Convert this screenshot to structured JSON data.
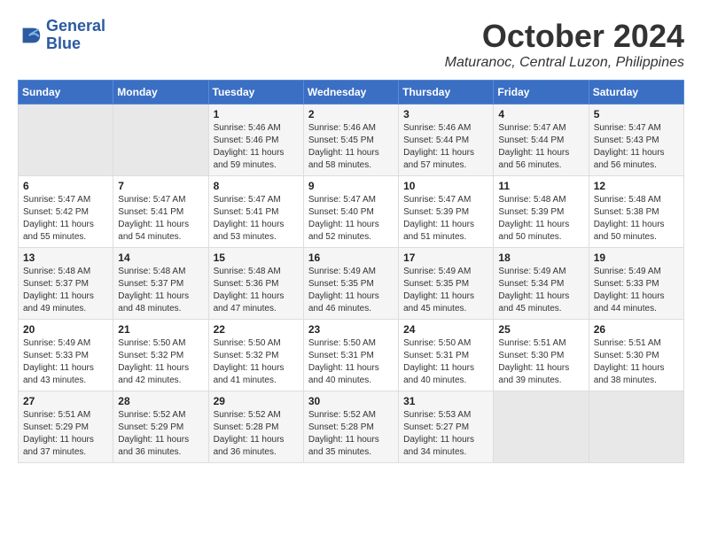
{
  "header": {
    "logo_line1": "General",
    "logo_line2": "Blue",
    "month_title": "October 2024",
    "location": "Maturanoc, Central Luzon, Philippines"
  },
  "days_of_week": [
    "Sunday",
    "Monday",
    "Tuesday",
    "Wednesday",
    "Thursday",
    "Friday",
    "Saturday"
  ],
  "weeks": [
    [
      {
        "day": "",
        "empty": true
      },
      {
        "day": "",
        "empty": true
      },
      {
        "day": "1",
        "sunrise": "5:46 AM",
        "sunset": "5:46 PM",
        "daylight": "11 hours and 59 minutes."
      },
      {
        "day": "2",
        "sunrise": "5:46 AM",
        "sunset": "5:45 PM",
        "daylight": "11 hours and 58 minutes."
      },
      {
        "day": "3",
        "sunrise": "5:46 AM",
        "sunset": "5:44 PM",
        "daylight": "11 hours and 57 minutes."
      },
      {
        "day": "4",
        "sunrise": "5:47 AM",
        "sunset": "5:44 PM",
        "daylight": "11 hours and 56 minutes."
      },
      {
        "day": "5",
        "sunrise": "5:47 AM",
        "sunset": "5:43 PM",
        "daylight": "11 hours and 56 minutes."
      }
    ],
    [
      {
        "day": "6",
        "sunrise": "5:47 AM",
        "sunset": "5:42 PM",
        "daylight": "11 hours and 55 minutes."
      },
      {
        "day": "7",
        "sunrise": "5:47 AM",
        "sunset": "5:41 PM",
        "daylight": "11 hours and 54 minutes."
      },
      {
        "day": "8",
        "sunrise": "5:47 AM",
        "sunset": "5:41 PM",
        "daylight": "11 hours and 53 minutes."
      },
      {
        "day": "9",
        "sunrise": "5:47 AM",
        "sunset": "5:40 PM",
        "daylight": "11 hours and 52 minutes."
      },
      {
        "day": "10",
        "sunrise": "5:47 AM",
        "sunset": "5:39 PM",
        "daylight": "11 hours and 51 minutes."
      },
      {
        "day": "11",
        "sunrise": "5:48 AM",
        "sunset": "5:39 PM",
        "daylight": "11 hours and 50 minutes."
      },
      {
        "day": "12",
        "sunrise": "5:48 AM",
        "sunset": "5:38 PM",
        "daylight": "11 hours and 50 minutes."
      }
    ],
    [
      {
        "day": "13",
        "sunrise": "5:48 AM",
        "sunset": "5:37 PM",
        "daylight": "11 hours and 49 minutes."
      },
      {
        "day": "14",
        "sunrise": "5:48 AM",
        "sunset": "5:37 PM",
        "daylight": "11 hours and 48 minutes."
      },
      {
        "day": "15",
        "sunrise": "5:48 AM",
        "sunset": "5:36 PM",
        "daylight": "11 hours and 47 minutes."
      },
      {
        "day": "16",
        "sunrise": "5:49 AM",
        "sunset": "5:35 PM",
        "daylight": "11 hours and 46 minutes."
      },
      {
        "day": "17",
        "sunrise": "5:49 AM",
        "sunset": "5:35 PM",
        "daylight": "11 hours and 45 minutes."
      },
      {
        "day": "18",
        "sunrise": "5:49 AM",
        "sunset": "5:34 PM",
        "daylight": "11 hours and 45 minutes."
      },
      {
        "day": "19",
        "sunrise": "5:49 AM",
        "sunset": "5:33 PM",
        "daylight": "11 hours and 44 minutes."
      }
    ],
    [
      {
        "day": "20",
        "sunrise": "5:49 AM",
        "sunset": "5:33 PM",
        "daylight": "11 hours and 43 minutes."
      },
      {
        "day": "21",
        "sunrise": "5:50 AM",
        "sunset": "5:32 PM",
        "daylight": "11 hours and 42 minutes."
      },
      {
        "day": "22",
        "sunrise": "5:50 AM",
        "sunset": "5:32 PM",
        "daylight": "11 hours and 41 minutes."
      },
      {
        "day": "23",
        "sunrise": "5:50 AM",
        "sunset": "5:31 PM",
        "daylight": "11 hours and 40 minutes."
      },
      {
        "day": "24",
        "sunrise": "5:50 AM",
        "sunset": "5:31 PM",
        "daylight": "11 hours and 40 minutes."
      },
      {
        "day": "25",
        "sunrise": "5:51 AM",
        "sunset": "5:30 PM",
        "daylight": "11 hours and 39 minutes."
      },
      {
        "day": "26",
        "sunrise": "5:51 AM",
        "sunset": "5:30 PM",
        "daylight": "11 hours and 38 minutes."
      }
    ],
    [
      {
        "day": "27",
        "sunrise": "5:51 AM",
        "sunset": "5:29 PM",
        "daylight": "11 hours and 37 minutes."
      },
      {
        "day": "28",
        "sunrise": "5:52 AM",
        "sunset": "5:29 PM",
        "daylight": "11 hours and 36 minutes."
      },
      {
        "day": "29",
        "sunrise": "5:52 AM",
        "sunset": "5:28 PM",
        "daylight": "11 hours and 36 minutes."
      },
      {
        "day": "30",
        "sunrise": "5:52 AM",
        "sunset": "5:28 PM",
        "daylight": "11 hours and 35 minutes."
      },
      {
        "day": "31",
        "sunrise": "5:53 AM",
        "sunset": "5:27 PM",
        "daylight": "11 hours and 34 minutes."
      },
      {
        "day": "",
        "empty": true
      },
      {
        "day": "",
        "empty": true
      }
    ]
  ],
  "labels": {
    "sunrise_prefix": "Sunrise:",
    "sunset_prefix": "Sunset:",
    "daylight_prefix": "Daylight:"
  }
}
